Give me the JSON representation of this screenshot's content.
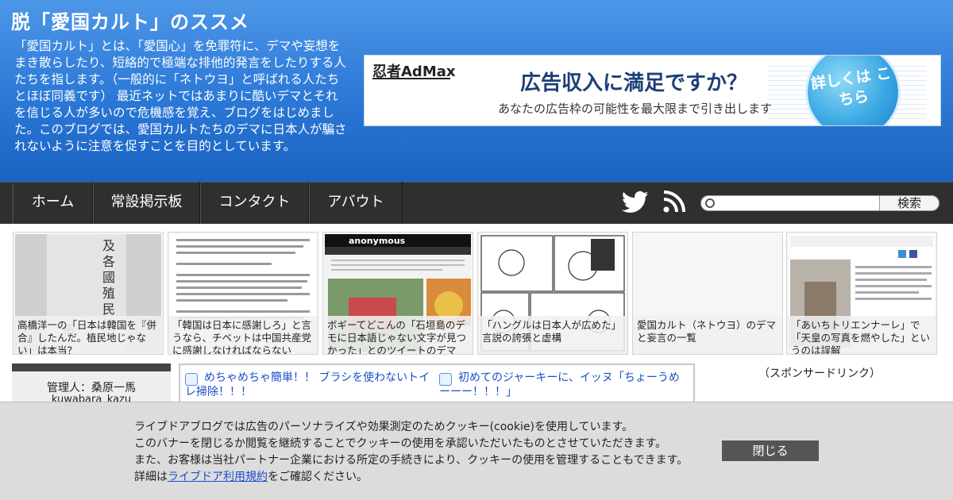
{
  "header": {
    "title": "脱「愛国カルト」のススメ",
    "description": "「愛国カルト」とは、「愛国心」を免罪符に、デマや妄想をまき散らしたり、短絡的で極端な排他的発言をしたりする人たちを指します。（一般的に「ネトウヨ」と呼ばれる人たちとほぼ同義です） 最近ネットではあまりに酷いデマとそれを信じる人が多いので危機感を覚え、ブログをはじめました。このブログでは、愛国カルトたちのデマに日本人が騙されないように注意を促すことを目的としています。"
  },
  "ad": {
    "logo": "忍者AdMax",
    "headline": "広告収入に満足ですか？",
    "sub": "あなたの広告枠の可能性を最大限まで引き出します",
    "cta": "詳しくは こちら"
  },
  "nav": {
    "items": [
      "ホーム",
      "常設掲示板",
      "コンタクト",
      "アバウト"
    ],
    "search_label": "検索"
  },
  "cards": [
    {
      "title": "高橋洋一の「日本は韓国を『併合』したんだ。植民地じゃない」は本当？"
    },
    {
      "title": "「韓国は日本に感謝しろ」と言うなら、チベットは中国共産党に感謝しなければならない"
    },
    {
      "title": "ボギーてどこんの「石垣島のデモに日本語じゃない文字が見つかった」とのツイートのデマ"
    },
    {
      "title": "「ハングルは日本人が広めた」言説の誇張と虚構"
    },
    {
      "title": "愛国カルト（ネトウヨ）のデマと妄言の一覧"
    },
    {
      "title": "「あいちトリエンナーレ」で「天皇の写真を燃やした」というのは誤解"
    }
  ],
  "sidebar": {
    "admin_label": "管理人：桑原一馬",
    "admin_id": "kuwabara_kazu"
  },
  "related": [
    {
      "title": "めちゃめちゃ簡単！！ ブラシを使わないトイレ掃除！！！"
    },
    {
      "title": "初めてのジャーキーに、イッヌ「ちょーうめーーー！！！」"
    }
  ],
  "sponsor_label": "（スポンサードリンク）",
  "cookie": {
    "line1": "ライブドアブログでは広告のパーソナライズや効果測定のためクッキー(cookie)を使用しています。",
    "line2": "このバナーを閉じるか閲覧を継続することでクッキーの使用を承認いただいたものとさせていただきます。",
    "line3": "また、お客様は当社パートナー企業における所定の手続きにより、クッキーの使用を管理することもできます。",
    "line4_prefix": "詳細は",
    "line4_link": "ライブドア利用規約",
    "line4_suffix": "をご確認ください。",
    "close_label": "閉じる"
  }
}
